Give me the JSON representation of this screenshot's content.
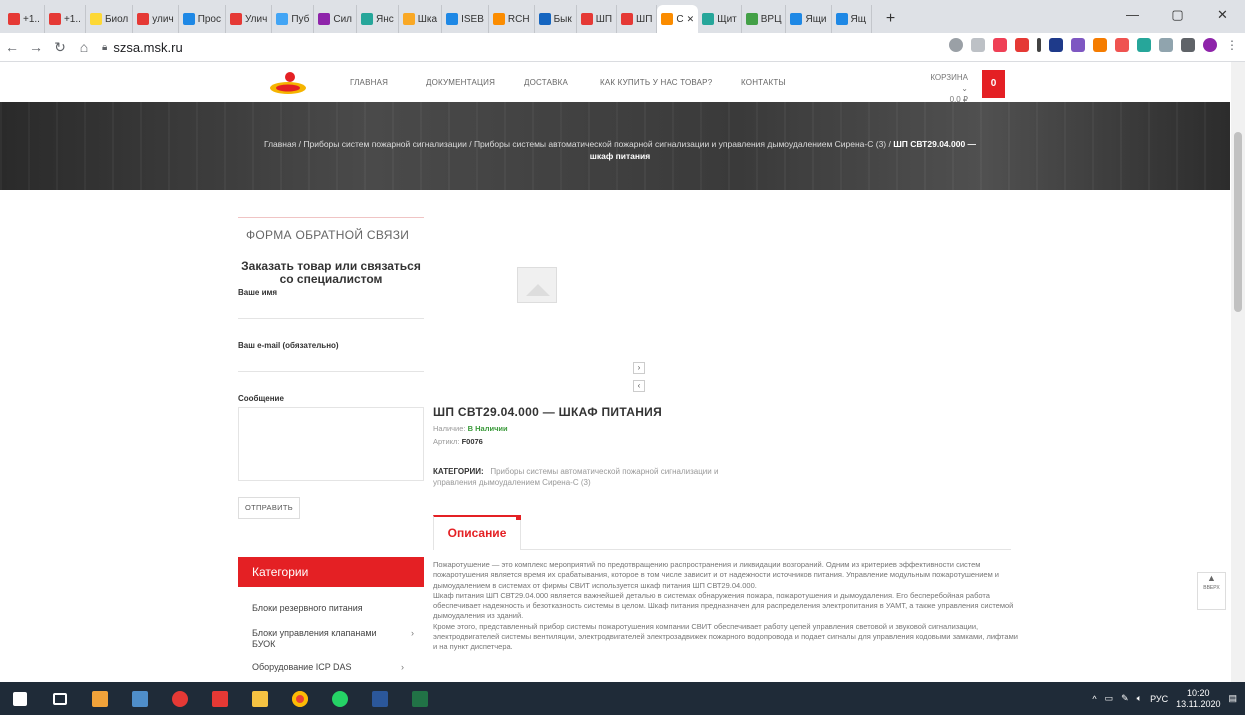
{
  "browser": {
    "tabs": [
      {
        "label": "+1..",
        "color": "#e53935"
      },
      {
        "label": "+1..",
        "color": "#e53935"
      },
      {
        "label": "Биол",
        "color": "#fdd835"
      },
      {
        "label": "улич",
        "color": "#e53935"
      },
      {
        "label": "Прос",
        "color": "#1e88e5"
      },
      {
        "label": "Улич",
        "color": "#e53935"
      },
      {
        "label": "Пуб",
        "color": "#42a5f5"
      },
      {
        "label": "Сил",
        "color": "#8e24aa"
      },
      {
        "label": "Янс",
        "color": "#26a69a"
      },
      {
        "label": "Шка",
        "color": "#f9a825"
      },
      {
        "label": "ISEB",
        "color": "#1e88e5"
      },
      {
        "label": "RCH",
        "color": "#fb8c00"
      },
      {
        "label": "Бык",
        "color": "#1565c0"
      },
      {
        "label": "ШП",
        "color": "#e53935"
      },
      {
        "label": "ШП",
        "color": "#e53935"
      },
      {
        "label": "С",
        "color": "#fb8c00",
        "active": true
      },
      {
        "label": "Щит",
        "color": "#26a69a"
      },
      {
        "label": "ВРЦ",
        "color": "#43a047"
      },
      {
        "label": "Ящи",
        "color": "#1e88e5"
      },
      {
        "label": "Ящ",
        "color": "#1e88e5"
      }
    ],
    "url": "szsa.msk.ru"
  },
  "nav": {
    "items": [
      "ГЛАВНАЯ",
      "ДОКУМЕНТАЦИЯ",
      "ДОСТАВКА",
      "КАК КУПИТЬ У НАС ТОВАР?",
      "КОНТАКТЫ"
    ],
    "cart_label": "КОРЗИНА",
    "cart_total": "0.0 ₽",
    "cart_count": "0"
  },
  "breadcrumb": {
    "text": "Главная / Приборы систем пожарной сигнализации / Приборы системы автоматической пожарной сигнализации и управления дымоудалением Сирена-С (3) / ",
    "current": "ШП СВТ29.04.000 — шкаф питания"
  },
  "feedback": {
    "title": "ФОРМА ОБРАТНОЙ СВЯЗИ",
    "subtitle": "Заказать товар или связаться со специалистом",
    "name_label": "Ваше имя",
    "email_label": "Ваш e-mail (обязательно)",
    "message_label": "Сообщение",
    "send_label": "ОТПРАВИТЬ"
  },
  "categories": {
    "title": "Категории",
    "items": [
      {
        "label": "Блоки резервного питания"
      },
      {
        "label": "Блоки управления клапанами БУОК"
      },
      {
        "label": "Оборудование ICP DAS"
      }
    ]
  },
  "product": {
    "title": "ШП СВТ29.04.000 — ШКАФ ПИТАНИЯ",
    "stock_label": "Наличие:",
    "stock_value": "В Наличии",
    "sku_label": "Артикл:",
    "sku_value": "F0076",
    "categories_label": "КАТЕГОРИИ:",
    "categories_value": "Приборы системы автоматической пожарной сигнализации и управления дымоудалением Сирена-С (3)"
  },
  "tabs": {
    "description": "Описание"
  },
  "description": [
    "Пожаротушение — это комплекс мероприятий по предотвращению распространения и ликвидации возгораний. Одним из критериев эффективности систем пожаротушения является время их срабатывания, которое в том числе зависит и от надежности источников питания. Управление модульным пожаротушением и дымоудалением в системах от фирмы СВИТ используется шкаф питания ШП СВТ29.04.000.",
    "Шкаф питания ШП СВТ29.04.000 является важнейшей деталью в системах обнаружения пожара, пожаротушения и дымоудаления. Его бесперебойная работа обеспечивает надежность и безотказность системы в целом. Шкаф питания предназначен для распределения электропитания в УАМТ, а также управления системой дымоудаления из зданий.",
    "Кроме этого, представленный прибор системы пожаротушения компании СВИТ обеспечивает работу цепей управления световой и звуковой сигнализации, электродвигателей системы вентиляции, электродвигателей электрозадвижек пожарного водопровода и подает сигналы для управления кодовыми замками, лифтами и на пункт диспетчера."
  ],
  "totop_label": "ВВЕРХ",
  "taskbar": {
    "lang": "РУС",
    "time": "10:20",
    "date": "13.11.2020"
  },
  "colors": {
    "accent": "#e42024",
    "stock": "#3a9a3a"
  }
}
